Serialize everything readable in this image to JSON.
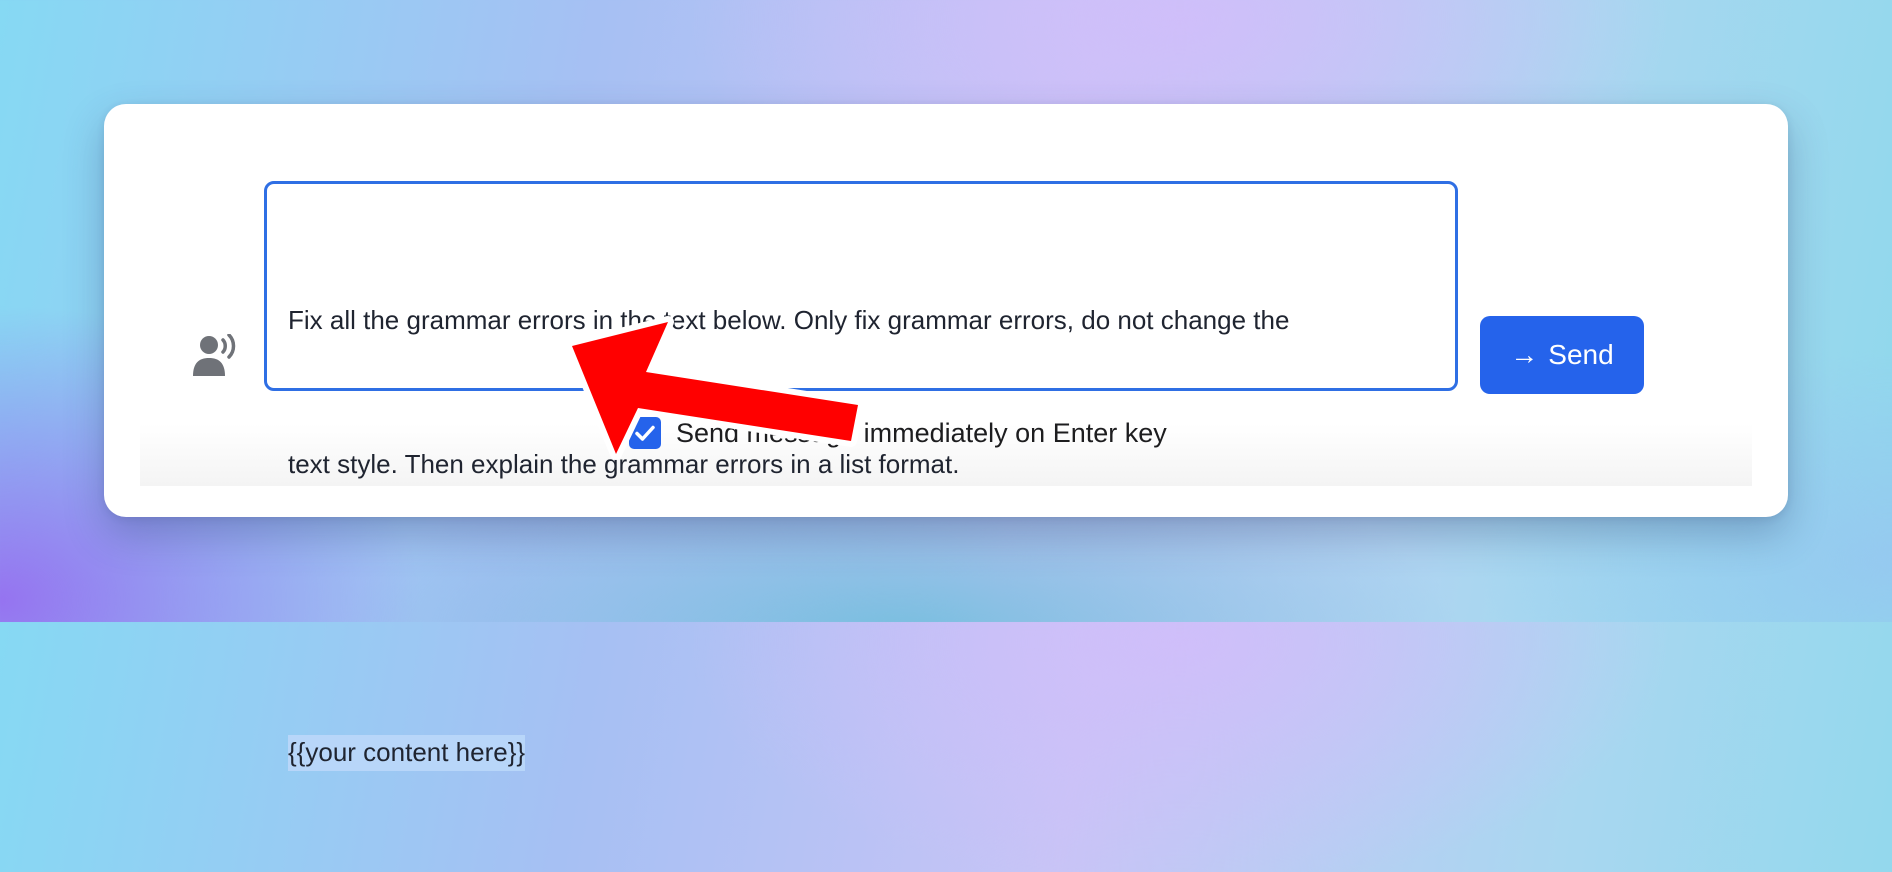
{
  "prompt": {
    "line1": "Fix all the grammar errors in the text below. Only fix grammar errors, do not change the",
    "line2": "text style. Then explain the grammar errors in a list format.",
    "line3": "",
    "placeholder_token": "{{your content here}}"
  },
  "send_button": {
    "icon": "arrow-right-icon",
    "label": "Send"
  },
  "enter_option": {
    "checked": true,
    "label": "Send message immediately on Enter key"
  },
  "voice_icon": "voice-input-icon",
  "annotation": {
    "arrow_color": "#ff0000",
    "arrow_outline": "#ffffff"
  },
  "colors": {
    "accent": "#2563eb",
    "selection": "#b8d6f9",
    "text": "#1f2430"
  }
}
